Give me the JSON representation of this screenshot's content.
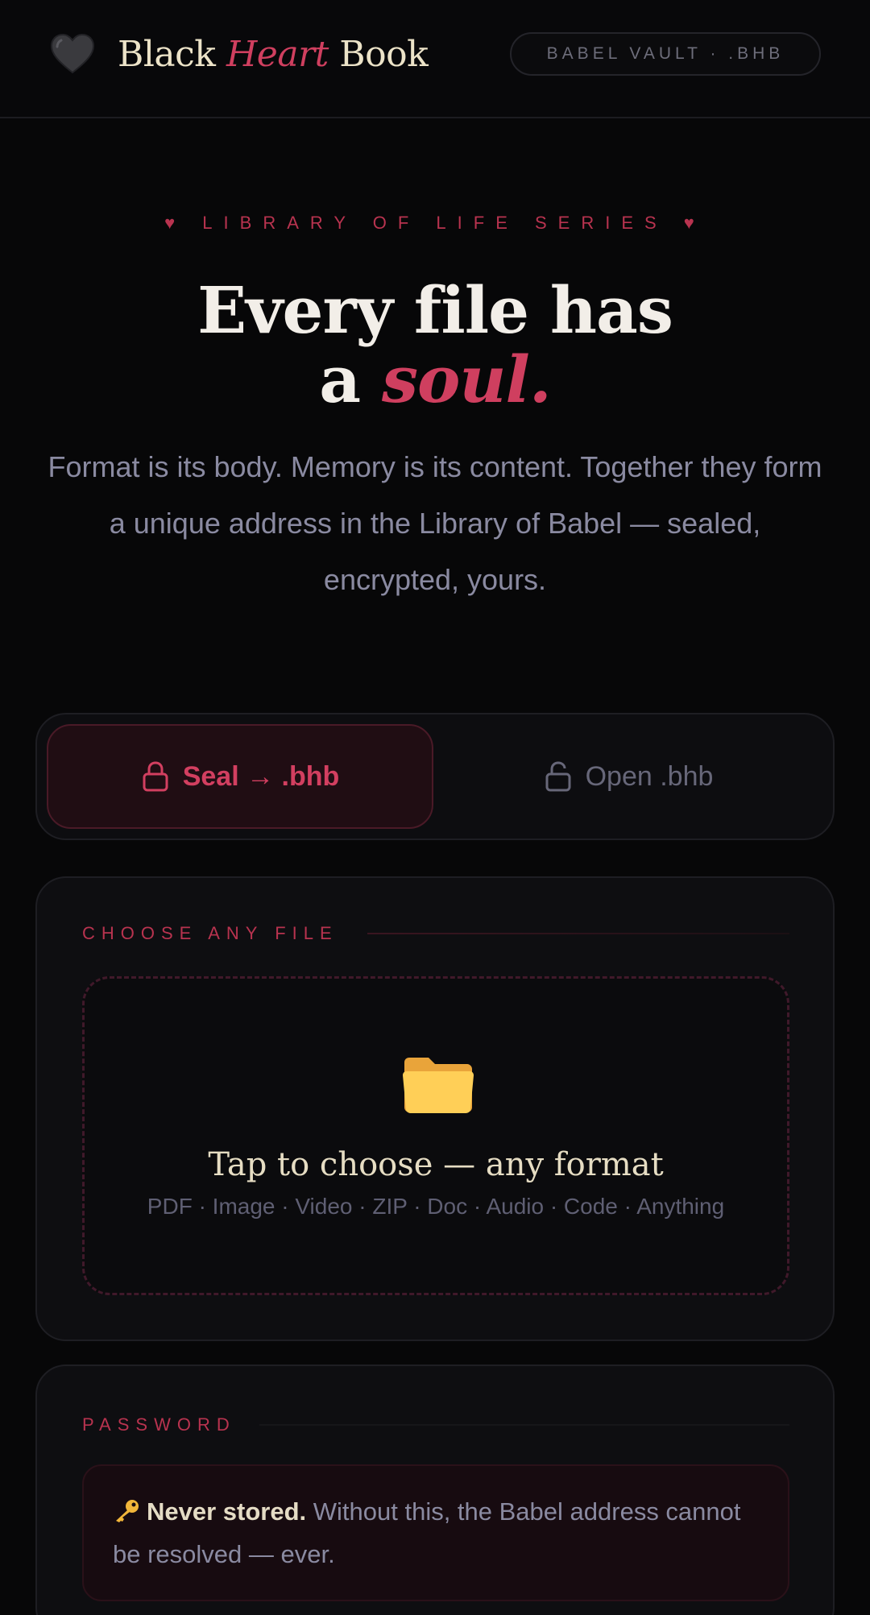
{
  "header": {
    "brand_pre": "Black ",
    "brand_accent": "Heart",
    "brand_post": " Book",
    "vault_badge": "BABEL VAULT · .BHB"
  },
  "hero": {
    "eyebrow": "♥ LIBRARY OF LIFE SERIES ♥",
    "title_line1": "Every file has",
    "title_line2_prefix": "a ",
    "title_line2_accent": "soul.",
    "subtitle": "Format is its body. Memory is its content. Together they form a unique address in the Library of Babel — sealed, encrypted, yours."
  },
  "tabs": {
    "seal_label": "Seal → .bhb",
    "open_label": "Open .bhb"
  },
  "file_section": {
    "label": "CHOOSE ANY FILE",
    "drop_title": "Tap to choose — any format",
    "formats": "PDF · Image · Video · ZIP · Doc · Audio · Code · Anything"
  },
  "password_section": {
    "label": "PASSWORD",
    "notice_strong": "Never stored.",
    "notice_text": " Without this, the Babel address cannot be resolved — ever."
  },
  "colors": {
    "accent": "#cf3f5f",
    "background": "#070708",
    "cream": "#ece3c8",
    "muted": "#8a8aa1"
  },
  "icons": [
    "black-heart-icon",
    "lock-icon",
    "unlock-icon",
    "folder-icon",
    "key-icon"
  ]
}
